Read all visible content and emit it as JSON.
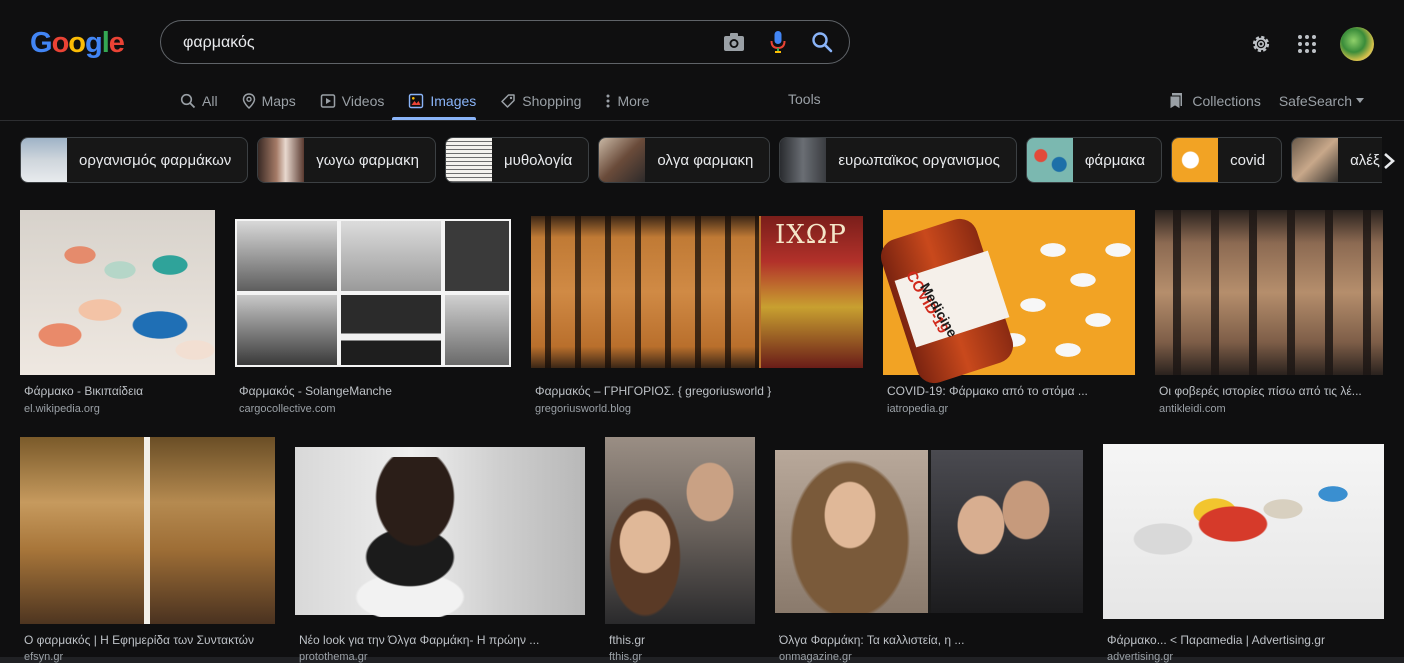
{
  "search": {
    "query": "φαρμακός"
  },
  "logo_text": "Google",
  "nav": {
    "tabs": [
      {
        "label": "All",
        "icon": "search-icon"
      },
      {
        "label": "Maps",
        "icon": "map-pin-icon"
      },
      {
        "label": "Videos",
        "icon": "video-icon"
      },
      {
        "label": "Images",
        "icon": "image-icon"
      },
      {
        "label": "Shopping",
        "icon": "tag-icon"
      },
      {
        "label": "More",
        "icon": "more-vert-icon"
      }
    ],
    "tools": "Tools",
    "collections": "Collections",
    "safesearch": "SafeSearch"
  },
  "chips": [
    {
      "label": "οργανισμός φαρμάκων",
      "color": "#cfd6dc"
    },
    {
      "label": "γωγω φαρμακη",
      "color": "#8a6b5e"
    },
    {
      "label": "μυθολογία",
      "color": "#e8e6e1"
    },
    {
      "label": "ολγα φαρμακη",
      "color": "#7a6a55"
    },
    {
      "label": "ευρωπαϊκος οργανισμος",
      "color": "#4a4d52"
    },
    {
      "label": "φάρμακα",
      "color": "#5fa3a8"
    },
    {
      "label": "covid",
      "color": "#f2a324"
    },
    {
      "label": "αλέξ",
      "color": "#8a7a6a"
    }
  ],
  "results": [
    {
      "title": "Φάρμακο - Βικιπαίδεια",
      "source": "el.wikipedia.org"
    },
    {
      "title": "Φαρμακός - SolangeManche",
      "source": "cargocollective.com"
    },
    {
      "title": "Φαρμακός – ΓΡΗΓΟΡΙΟΣ. { gregoriusworld }",
      "source": "gregoriusworld.blog"
    },
    {
      "title": "COVID-19: Φάρμακο από το στόμα ...",
      "source": "iatropedia.gr"
    },
    {
      "title": "Οι φοβερές ιστορίες πίσω από τις λέ...",
      "source": "antikleidi.com"
    },
    {
      "title": "Ο φαρμακός | Η Εφημερίδα των Συντακτών",
      "source": "efsyn.gr"
    },
    {
      "title": "Νέο look για την Όλγα Φαρμάκη- Η πρώην ...",
      "source": "protothema.gr"
    },
    {
      "title": "fthis.gr",
      "source": "fthis.gr"
    },
    {
      "title": "Όλγα Φαρμάκη: Τα καλλιστεία, η ...",
      "source": "onmagazine.gr"
    },
    {
      "title": "Φάρμακο... < Παραmedia | Advertising.gr",
      "source": "advertising.gr"
    }
  ],
  "image_text": {
    "covid_label": "COVID-19",
    "medicine_label": "Medicine",
    "magazine_title": "ΙΧΩΡ"
  }
}
